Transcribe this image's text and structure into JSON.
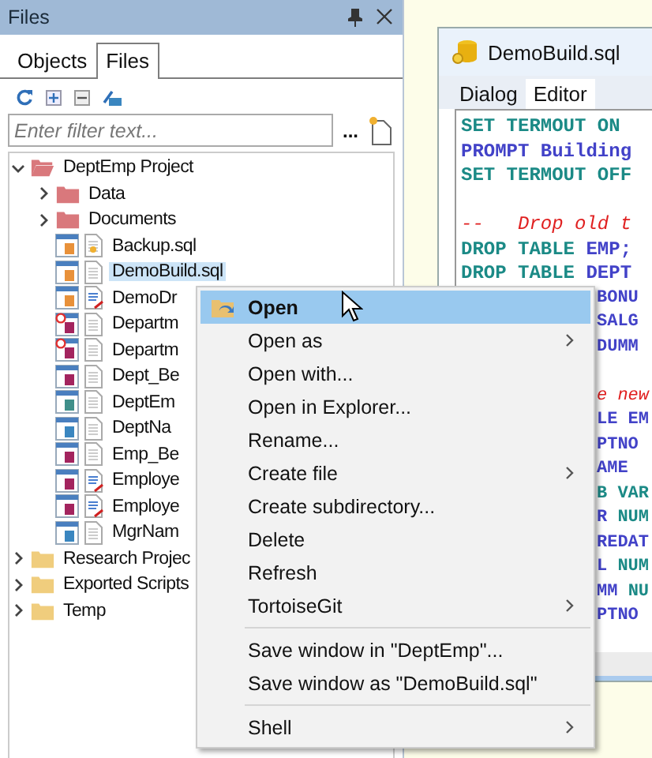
{
  "panel": {
    "title": "Files",
    "tabs": [
      {
        "label": "Objects",
        "selected": false
      },
      {
        "label": "Files",
        "selected": true
      }
    ],
    "filter": {
      "placeholder": "Enter filter text..."
    },
    "more_label": "..."
  },
  "tree": [
    {
      "label": "DeptEmp Project",
      "kind": "project",
      "expanded": true,
      "children": [
        {
          "label": "Data",
          "kind": "folder",
          "expanded": false
        },
        {
          "label": "Documents",
          "kind": "folder",
          "expanded": false
        },
        {
          "label": "Backup.sql",
          "kind": "file",
          "new": true,
          "modified": false,
          "color": "#e8913a",
          "blocked": false,
          "selected": false
        },
        {
          "label": "DemoBuild.sql",
          "kind": "file",
          "new": false,
          "modified": false,
          "color": "#e8913a",
          "blocked": false,
          "selected": true
        },
        {
          "label": "DemoDr",
          "kind": "file",
          "new": false,
          "modified": true,
          "color": "#e8913a",
          "blocked": false,
          "selected": false
        },
        {
          "label": "Departm",
          "kind": "file",
          "new": false,
          "modified": false,
          "color": "#a3245e",
          "blocked": true,
          "selected": false
        },
        {
          "label": "Departm",
          "kind": "file",
          "new": false,
          "modified": false,
          "color": "#a3245e",
          "blocked": true,
          "selected": false
        },
        {
          "label": "Dept_Be",
          "kind": "file",
          "new": false,
          "modified": false,
          "color": "#a3245e",
          "blocked": false,
          "selected": false
        },
        {
          "label": "DeptEm",
          "kind": "file",
          "new": false,
          "modified": false,
          "color": "#3f8f8a",
          "blocked": false,
          "selected": false
        },
        {
          "label": "DeptNa",
          "kind": "file",
          "new": false,
          "modified": false,
          "color": "#3a86c0",
          "blocked": false,
          "selected": false
        },
        {
          "label": "Emp_Be",
          "kind": "file",
          "new": false,
          "modified": false,
          "color": "#a3245e",
          "blocked": false,
          "selected": false
        },
        {
          "label": "Employe",
          "kind": "file",
          "new": false,
          "modified": true,
          "color": "#a3245e",
          "blocked": false,
          "selected": false
        },
        {
          "label": "Employe",
          "kind": "file",
          "new": false,
          "modified": true,
          "color": "#a3245e",
          "blocked": false,
          "selected": false
        },
        {
          "label": "MgrNam",
          "kind": "file",
          "new": false,
          "modified": false,
          "color": "#3a86c0",
          "blocked": false,
          "selected": false
        }
      ]
    },
    {
      "label": "Research Projec",
      "kind": "plainfolder",
      "expanded": false
    },
    {
      "label": "Exported Scripts",
      "kind": "plainfolder",
      "expanded": false
    },
    {
      "label": "Temp",
      "kind": "plainfolder",
      "expanded": false
    }
  ],
  "editor_window": {
    "title": "DemoBuild.sql",
    "tabs": [
      {
        "label": "Dialog",
        "selected": false
      },
      {
        "label": "Editor",
        "selected": true
      }
    ],
    "lines": [
      {
        "kind": "code",
        "covered": false,
        "segments": [
          {
            "text": "SET TERMOUT ON",
            "kind": "keyword"
          }
        ]
      },
      {
        "kind": "code",
        "covered": false,
        "segments": [
          {
            "text": "PROMPT Building",
            "kind": "text"
          }
        ]
      },
      {
        "kind": "code",
        "covered": false,
        "segments": [
          {
            "text": "SET TERMOUT OFF",
            "kind": "keyword"
          }
        ]
      },
      {
        "kind": "blank"
      },
      {
        "kind": "code",
        "covered": false,
        "segments": [
          {
            "text": "--   Drop old t",
            "kind": "comment"
          }
        ]
      },
      {
        "kind": "code",
        "covered": false,
        "segments": [
          {
            "text": "DROP TABLE ",
            "kind": "keyword"
          },
          {
            "text": "EMP;",
            "kind": "text"
          }
        ]
      },
      {
        "kind": "code",
        "covered": false,
        "segments": [
          {
            "text": "DROP TABLE ",
            "kind": "keyword"
          },
          {
            "text": "DEPT",
            "kind": "text"
          }
        ]
      },
      {
        "kind": "code",
        "covered": true,
        "segments": [
          {
            "text": "BONU",
            "kind": "text"
          }
        ]
      },
      {
        "kind": "code",
        "covered": true,
        "segments": [
          {
            "text": "SALG",
            "kind": "text"
          }
        ]
      },
      {
        "kind": "code",
        "covered": true,
        "segments": [
          {
            "text": "DUMM",
            "kind": "text"
          }
        ]
      },
      {
        "kind": "blank"
      },
      {
        "kind": "code",
        "covered": true,
        "segments": [
          {
            "text": "e new",
            "kind": "comment"
          }
        ]
      },
      {
        "kind": "code",
        "covered": true,
        "segments": [
          {
            "text": "LE EM",
            "kind": "text"
          }
        ]
      },
      {
        "kind": "code",
        "covered": true,
        "segments": [
          {
            "text": "PTNO",
            "kind": "text"
          }
        ]
      },
      {
        "kind": "code",
        "covered": true,
        "segments": [
          {
            "text": "AME",
            "kind": "text"
          }
        ]
      },
      {
        "kind": "code",
        "covered": true,
        "segments": [
          {
            "text": "B VAR",
            "kind": "keyword"
          }
        ]
      },
      {
        "kind": "code",
        "covered": true,
        "segments": [
          {
            "text": "R ",
            "kind": "text"
          },
          {
            "text": "NUM",
            "kind": "keyword"
          }
        ]
      },
      {
        "kind": "code",
        "covered": true,
        "segments": [
          {
            "text": "REDAT",
            "kind": "text"
          }
        ]
      },
      {
        "kind": "code",
        "covered": true,
        "segments": [
          {
            "text": "L ",
            "kind": "text"
          },
          {
            "text": "NUM",
            "kind": "keyword"
          }
        ]
      },
      {
        "kind": "code",
        "covered": true,
        "segments": [
          {
            "text": "MM ",
            "kind": "text"
          },
          {
            "text": "NU",
            "kind": "keyword"
          }
        ]
      },
      {
        "kind": "code",
        "covered": true,
        "segments": [
          {
            "text": "PTNO",
            "kind": "text"
          }
        ]
      }
    ]
  },
  "context_menu": [
    {
      "kind": "item",
      "label": "Open",
      "selected": true,
      "submenu": false,
      "icon": true
    },
    {
      "kind": "item",
      "label": "Open as",
      "selected": false,
      "submenu": true,
      "icon": false
    },
    {
      "kind": "item",
      "label": "Open with...",
      "selected": false,
      "submenu": false,
      "icon": false
    },
    {
      "kind": "item",
      "label": "Open in Explorer...",
      "selected": false,
      "submenu": false,
      "icon": false
    },
    {
      "kind": "item",
      "label": "Rename...",
      "selected": false,
      "submenu": false,
      "icon": false
    },
    {
      "kind": "item",
      "label": "Create file",
      "selected": false,
      "submenu": true,
      "icon": false
    },
    {
      "kind": "item",
      "label": "Create subdirectory...",
      "selected": false,
      "submenu": false,
      "icon": false
    },
    {
      "kind": "item",
      "label": "Delete",
      "selected": false,
      "submenu": false,
      "icon": false
    },
    {
      "kind": "item",
      "label": "Refresh",
      "selected": false,
      "submenu": false,
      "icon": false
    },
    {
      "kind": "item",
      "label": "TortoiseGit",
      "selected": false,
      "submenu": true,
      "icon": false
    },
    {
      "kind": "separator"
    },
    {
      "kind": "item",
      "label": "Save window in \"DeptEmp\"...",
      "selected": false,
      "submenu": false,
      "icon": false
    },
    {
      "kind": "item",
      "label": "Save window as \"DemoBuild.sql\"",
      "selected": false,
      "submenu": false,
      "icon": false
    },
    {
      "kind": "separator"
    },
    {
      "kind": "item",
      "label": "Shell",
      "selected": false,
      "submenu": true,
      "icon": false
    }
  ]
}
